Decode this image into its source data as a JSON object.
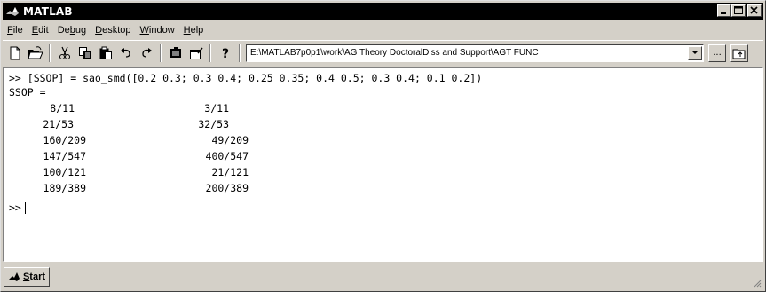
{
  "window": {
    "title": "MATLAB",
    "icon": "matlab-logo-icon",
    "controls": [
      "minimize-icon",
      "maximize-icon",
      "close-icon"
    ]
  },
  "menu": [
    {
      "label": "File",
      "u": "F",
      "rest": "ile"
    },
    {
      "label": "Edit",
      "u": "E",
      "rest": "dit"
    },
    {
      "label": "Debug",
      "pre": "De",
      "u": "b",
      "rest": "ug"
    },
    {
      "label": "Desktop",
      "u": "D",
      "rest": "esktop"
    },
    {
      "label": "Window",
      "u": "W",
      "rest": "indow"
    },
    {
      "label": "Help",
      "u": "H",
      "rest": "elp"
    }
  ],
  "toolbar": {
    "icons": [
      "new-file-icon",
      "open-folder-icon",
      "cut-icon",
      "copy-icon",
      "paste-icon",
      "undo-icon",
      "redo-icon",
      "simulink-icon",
      "guide-icon",
      "help-icon"
    ],
    "current_directory": "E:\\MATLAB7p0p1\\work\\AG Theory DoctoralDiss and Support\\AGT FUNC",
    "browse_label": "...",
    "up_folder_icon": "up-folder-icon"
  },
  "command_window": {
    "command": ">> [SSOP] = sao_smd([0.2 0.3; 0.3 0.4; 0.25 0.35; 0.4 0.5; 0.3 0.4; 0.1 0.2])",
    "result_name": "SSOP =",
    "rows": [
      [
        "8/11",
        "3/11"
      ],
      [
        "21/53",
        "32/53"
      ],
      [
        "160/209",
        "49/209"
      ],
      [
        "147/547",
        "400/547"
      ],
      [
        "100/121",
        "21/121"
      ],
      [
        "189/389",
        "200/389"
      ]
    ],
    "prompt": ">>"
  },
  "statusbar": {
    "start_label_u": "S",
    "start_label_rest": "tart",
    "start_icon": "matlab-start-icon"
  }
}
